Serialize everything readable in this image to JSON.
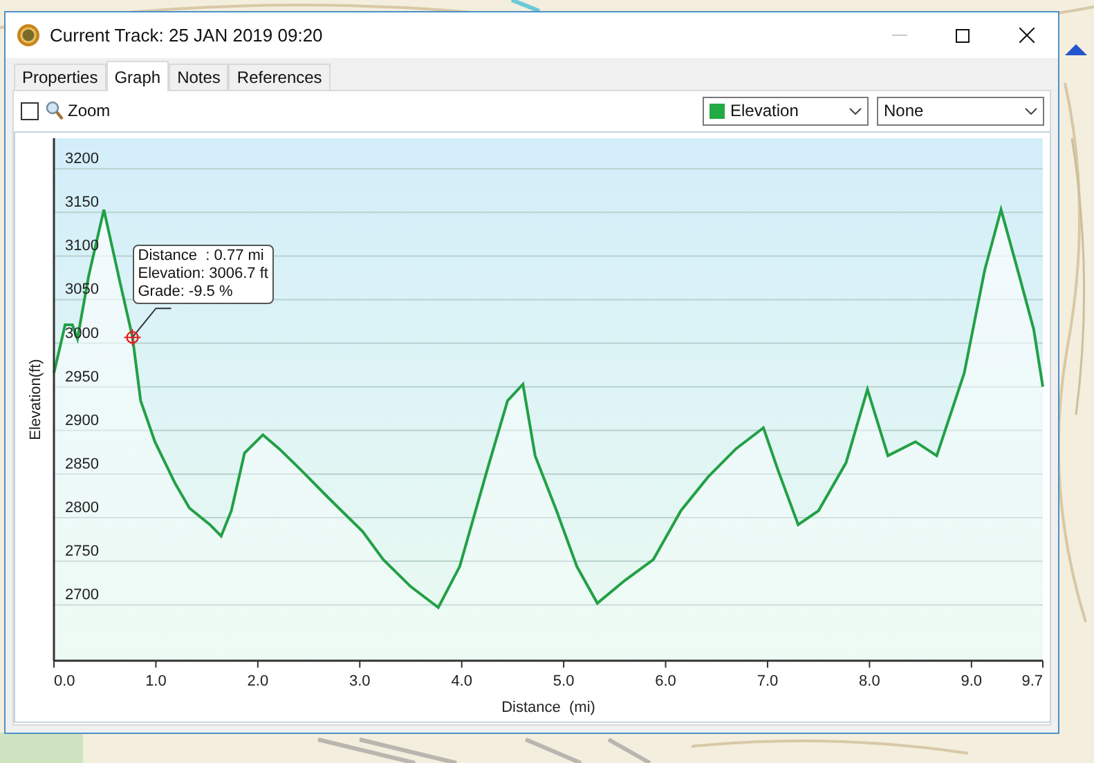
{
  "window": {
    "title": "Current Track: 25 JAN 2019 09:20"
  },
  "tabs": [
    {
      "label": "Properties",
      "selected": false
    },
    {
      "label": "Graph",
      "selected": true
    },
    {
      "label": "Notes",
      "selected": false
    },
    {
      "label": "References",
      "selected": false
    }
  ],
  "graph": {
    "zoom": {
      "label": "Zoom",
      "checked": false
    },
    "selects": [
      {
        "value": "Elevation",
        "color": "#22aa44"
      },
      {
        "value": "None"
      }
    ],
    "chart_data": {
      "type": "area",
      "grid": true,
      "xlabel": "Distance  (mi)",
      "ylabel": "Elevation(ft)",
      "xlim": [
        0,
        9.7
      ],
      "ylim": [
        2636,
        3235
      ],
      "xticks": [
        {
          "value": 0,
          "label": "0.0"
        },
        {
          "value": 1,
          "label": "1.0"
        },
        {
          "value": 2,
          "label": "2.0"
        },
        {
          "value": 3,
          "label": "3.0"
        },
        {
          "value": 4,
          "label": "4.0"
        },
        {
          "value": 5,
          "label": "5.0"
        },
        {
          "value": 6,
          "label": "6.0"
        },
        {
          "value": 7,
          "label": "7.0"
        },
        {
          "value": 8,
          "label": "8.0"
        },
        {
          "value": 9,
          "label": "9.0"
        },
        {
          "value": 9.7,
          "label": "9.7"
        }
      ],
      "yticks": [
        2700,
        2750,
        2800,
        2850,
        2900,
        2950,
        3000,
        3050,
        3100,
        3150,
        3200
      ],
      "x": [
        0,
        0.11,
        0.18,
        0.23,
        0.34,
        0.49,
        0.65,
        0.77,
        0.85,
        0.99,
        1.19,
        1.33,
        1.53,
        1.64,
        1.74,
        1.87,
        2.05,
        2.21,
        2.42,
        2.69,
        3.03,
        3.23,
        3.5,
        3.77,
        3.98,
        4.25,
        4.45,
        4.6,
        4.72,
        4.93,
        5.13,
        5.33,
        5.6,
        5.88,
        6.15,
        6.42,
        6.69,
        6.96,
        7.1,
        7.3,
        7.5,
        7.77,
        7.98,
        8.18,
        8.45,
        8.66,
        8.93,
        9.13,
        9.29,
        9.47,
        9.61,
        9.7
      ],
      "series": [
        {
          "color": "#22a046",
          "values": [
            2966,
            3021,
            3021,
            3005,
            3077,
            3153,
            3069,
            3007,
            2934,
            2887,
            2839,
            2811,
            2792,
            2779,
            2808,
            2874,
            2895,
            2879,
            2855,
            2823,
            2784,
            2752,
            2721,
            2697,
            2744,
            2855,
            2934,
            2953,
            2871,
            2808,
            2744,
            2702,
            2728,
            2752,
            2808,
            2847,
            2879,
            2903,
            2855,
            2792,
            2808,
            2863,
            2947,
            2871,
            2887,
            2871,
            2966,
            3084,
            3153,
            3077,
            3016,
            2950
          ]
        }
      ],
      "annotations": [
        {
          "x": 0.77,
          "y": 3006.7,
          "text": "Distance  : 0.77 mi\nElevation: 3006.7 ft\nGrade: -9.5 %"
        }
      ]
    }
  }
}
